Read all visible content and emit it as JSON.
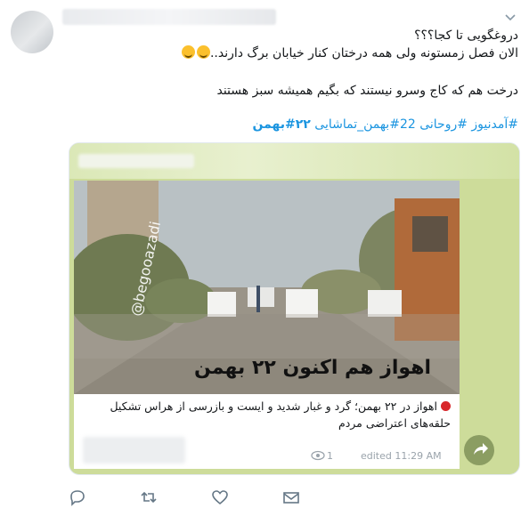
{
  "tweet": {
    "line1": "دروغگویی تا کجا؟؟؟",
    "line2": "الان فصل زمستونه ولی همه درختان کنار خیابان برگ دارند..",
    "line3": "درخت هم که کاج وسرو نیستند که بگیم همیشه سبز هستند",
    "hashtags_pre": "#آمدنیوز #روحانی 22#بهمن_تماشایی ",
    "hashtags_bold": "۲۲#بهمن"
  },
  "card": {
    "watermark": "@begooazadi",
    "image_headline": "اهواز هم اکنون ۲۲ بهمن",
    "caption": "اهواز در ۲۲ بهمن؛ گرد و غبار شدید و ایست و بازرسی از هراس تشکیل حلقه‌های اعتراضی مردم",
    "views": "1",
    "edited": "edited 11:29 AM"
  },
  "icons": {
    "caret": "chevron-down-icon",
    "reply": "reply-icon",
    "retweet": "retweet-icon",
    "like": "heart-icon",
    "dm": "envelope-icon",
    "share": "share-arrow-icon",
    "eye": "eye-icon"
  },
  "colors": {
    "link": "#1b95e0",
    "icon": "#657786",
    "card_bg": "#cddc9a"
  }
}
